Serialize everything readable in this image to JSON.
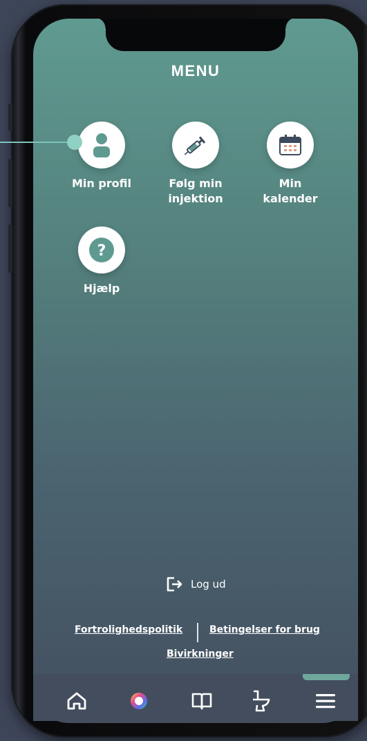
{
  "title": "MENU",
  "menu_items": [
    {
      "label": "Min profil",
      "icon": "user-icon"
    },
    {
      "label": "Følg min\ninjektion",
      "icon": "syringe-icon"
    },
    {
      "label": "Min\nkalender",
      "icon": "calendar-icon"
    },
    {
      "label": "Hjælp",
      "icon": "help-question-icon"
    }
  ],
  "logout": {
    "label": "Log ud",
    "icon": "logout-icon"
  },
  "footer": {
    "privacy": "Fortrolighedspolitik",
    "terms": "Betingelser for brug",
    "side_effects": "Bivirkninger"
  },
  "tabs": [
    {
      "icon": "home-icon"
    },
    {
      "icon": "color-wheel-icon"
    },
    {
      "icon": "book-icon"
    },
    {
      "icon": "toilet-icon"
    },
    {
      "icon": "hamburger-menu-icon",
      "active": true
    }
  ],
  "colors": {
    "accent": "#6fa79c",
    "screen_top": "#5f9a90",
    "screen_bottom": "#434f5f",
    "background": "#3d4558"
  }
}
